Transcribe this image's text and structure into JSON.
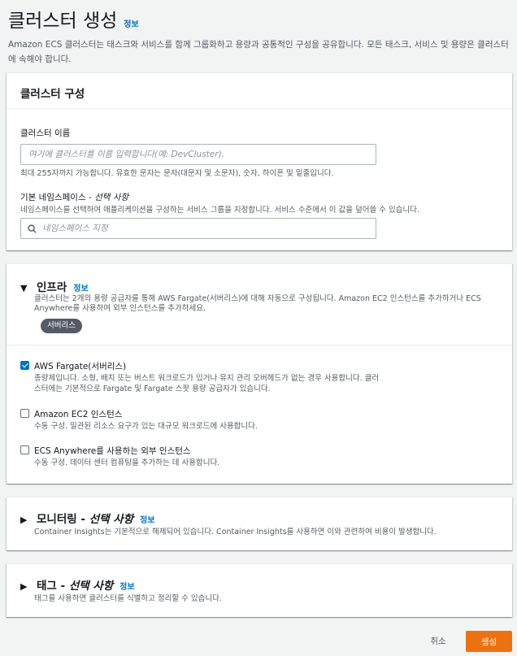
{
  "header": {
    "title": "클러스터 생성",
    "info": "정보",
    "description": "Amazon ECS 클러스터는 태스크와 서비스를 함께 그룹화하고 용량과 공통적인 구성을 공유합니다. 모든 태스크, 서비스 및 용량은 클러스터에 속해야 합니다."
  },
  "config": {
    "title": "클러스터 구성",
    "name_label": "클러스터 이름",
    "name_placeholder": "여기에 클러스터를 이름 입력합니다(예: DevCluster).",
    "name_constraint": "최대 255자까지 가능합니다. 유효한 문자는 문자(대문자 및 소문자), 숫자, 하이픈 및 밑줄입니다.",
    "namespace_label": "기본 네임스페이스 - ",
    "namespace_optional": "선택 사항",
    "namespace_desc": "네임스페이스를 선택하여 애플리케이션을 구성하는 서비스 그룹을 지정합니다. 서비스 수준에서 이 값을 덮어쓸 수 있습니다.",
    "namespace_placeholder": "네임스페이스 지정"
  },
  "infra": {
    "title": "인프라",
    "info": "정보",
    "description": "클러스터는 2개의 용량 공급자를 통해 AWS Fargate(서버리스)에 대해 자동으로 구성됩니다. Amazon EC2 인스턴스를 추가하거나 ECS Anywhere를 사용하여 외부 인스턴스를 추가하세요.",
    "badge": "서버리스",
    "options": [
      {
        "label": "AWS Fargate(서버리스)",
        "checked": true,
        "desc": "종량제입니다. 소형, 배치 또는 버스트 워크로드가 있거나 유지 관리 오버헤드가 없는 경우 사용합니다. 클러스터에는 기본적으로 Fargate 및 Fargate 스팟 용량 공급자가 있습니다."
      },
      {
        "label": "Amazon EC2 인스턴스",
        "checked": false,
        "desc": "수동 구성. 일관된 리소스 요구가 있는 대규모 워크로드에 사용합니다."
      },
      {
        "label": "ECS Anywhere를 사용하는 외부 인스턴스",
        "checked": false,
        "desc": "수동 구성. 데이터 센터 컴퓨팅을 추가하는 데 사용합니다."
      }
    ]
  },
  "monitoring": {
    "title": "모니터링 - ",
    "optional": "선택 사항",
    "info": "정보",
    "description": "Container Insights는 기본적으로 해제되어 있습니다. Container Insights를 사용하면 이와 관련하여 비용이 발생합니다."
  },
  "tags": {
    "title": "태그 - ",
    "optional": "선택 사항",
    "info": "정보",
    "description": "태그를 사용하면 클러스터를 식별하고 정리할 수 있습니다."
  },
  "footer": {
    "cancel": "취소",
    "create": "생성"
  },
  "colors": {
    "primary": "#ec7211",
    "link": "#0073bb",
    "checkbox": "#0073bb"
  }
}
